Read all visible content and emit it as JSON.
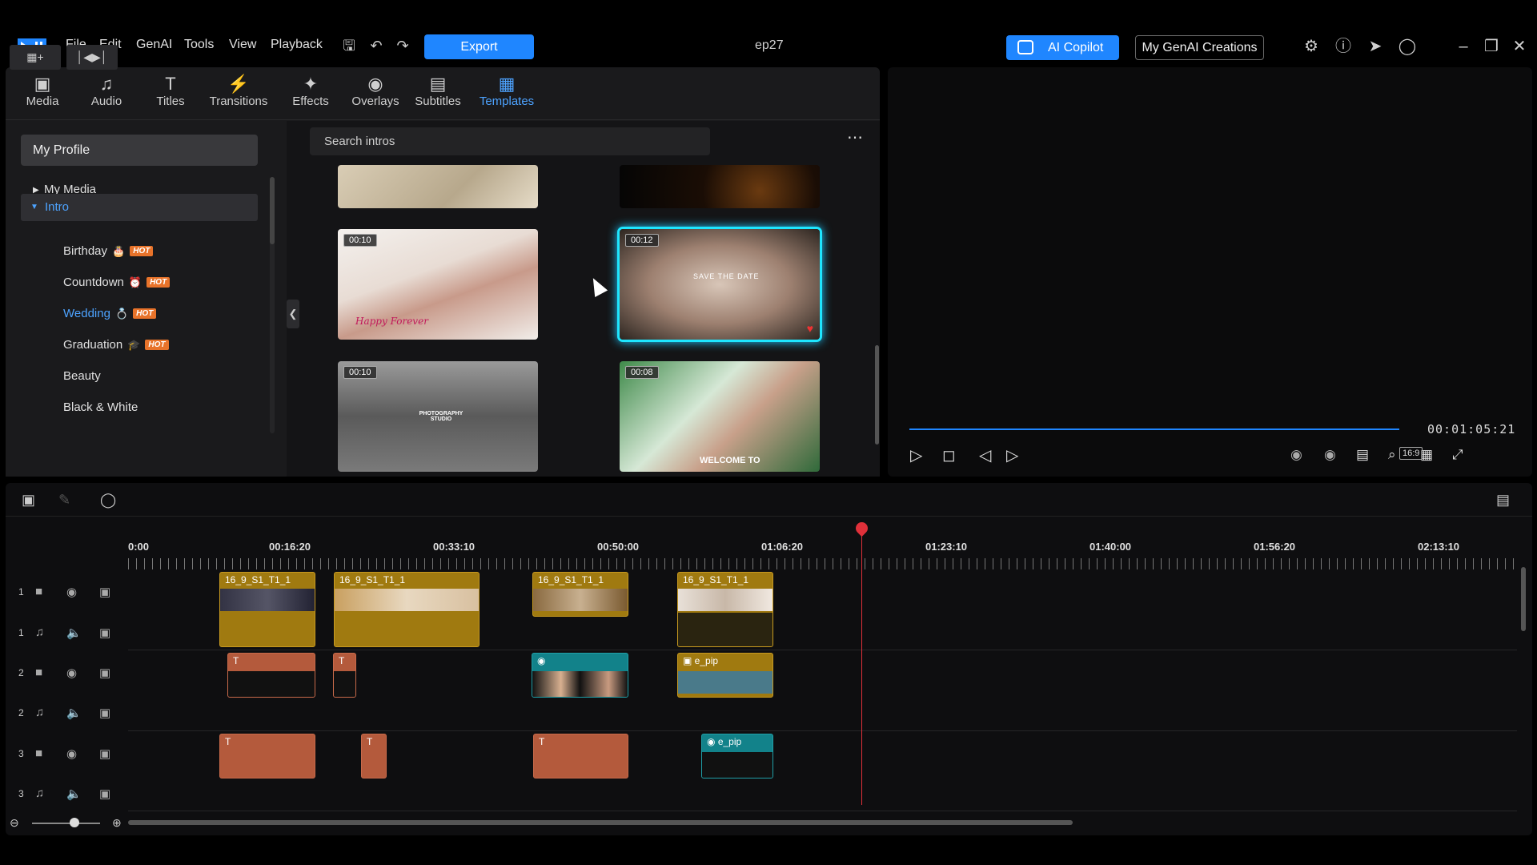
{
  "menu": {
    "file": "File",
    "edit": "Edit",
    "genai": "GenAI",
    "tools": "Tools",
    "view": "View",
    "playback": "Playback"
  },
  "toolbar": {
    "export_label": "Export",
    "project_title": "ep27",
    "copilot_label": "AI Copilot",
    "creations_label": "My GenAI Creations"
  },
  "tabs": [
    {
      "label": "Media",
      "icon": "media-icon"
    },
    {
      "label": "Audio",
      "icon": "music-note-icon"
    },
    {
      "label": "Titles",
      "icon": "title-t-icon"
    },
    {
      "label": "Transitions",
      "icon": "transition-icon"
    },
    {
      "label": "Effects",
      "icon": "effects-icon"
    },
    {
      "label": "Overlays",
      "icon": "overlay-icon"
    },
    {
      "label": "Subtitles",
      "icon": "subtitles-icon"
    },
    {
      "label": "Templates",
      "icon": "templates-icon"
    }
  ],
  "sidebar": {
    "profile": "My Profile",
    "my_media": "My Media",
    "intro": "Intro",
    "categories": [
      {
        "label": "Birthday",
        "badge": "HOT",
        "icon": "cake-icon"
      },
      {
        "label": "Countdown",
        "badge": "HOT",
        "icon": "alarm-icon"
      },
      {
        "label": "Wedding",
        "badge": "HOT",
        "icon": "ring-icon"
      },
      {
        "label": "Graduation",
        "badge": "HOT",
        "icon": "grad-cap-icon"
      },
      {
        "label": "Beauty",
        "badge": "",
        "icon": ""
      },
      {
        "label": "Black & White",
        "badge": "",
        "icon": ""
      }
    ]
  },
  "search": {
    "placeholder": "Search intros"
  },
  "templates": [
    {
      "duration": "00:10",
      "caption": "Happy Forever"
    },
    {
      "duration": "00:12",
      "caption": "SAVE THE DATE"
    },
    {
      "duration": "00:10",
      "caption": "PHOTOGRAPHY STUDIO"
    },
    {
      "duration": "00:08",
      "caption": "WELCOME TO"
    }
  ],
  "preview": {
    "timecode": "00:01:05:21",
    "progress": 1.0,
    "ratio": "16:9"
  },
  "timeline": {
    "ticks": [
      "0:00",
      "00:16:20",
      "00:33:10",
      "00:50:00",
      "01:06:20",
      "01:23:10",
      "01:40:00",
      "01:56:20",
      "02:13:10"
    ],
    "tracks": [
      {
        "number": "1",
        "type": "video"
      },
      {
        "number": "1",
        "type": "audio"
      },
      {
        "number": "2",
        "type": "video"
      },
      {
        "number": "2",
        "type": "audio"
      },
      {
        "number": "3",
        "type": "video"
      },
      {
        "number": "3",
        "type": "audio"
      }
    ],
    "video_clip_label": "16_9_S1_T1_1",
    "pip_label": "e_pip",
    "title_glyph": "T"
  },
  "colors": {
    "accent": "#1f86ff",
    "hot": "#e8732a",
    "playhead": "#e0303a",
    "selection_glow": "#1ee6ff"
  }
}
